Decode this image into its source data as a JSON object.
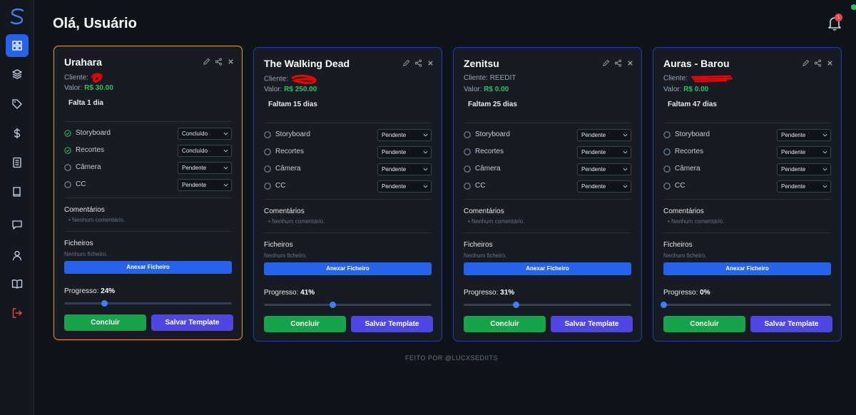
{
  "header": {
    "greeting": "Olá, Usuário",
    "notification_count": "1"
  },
  "sidebar": {
    "items": [
      {
        "name": "dashboard-icon",
        "active": true
      },
      {
        "name": "layers-icon",
        "active": false
      },
      {
        "name": "tag-icon",
        "active": false
      },
      {
        "name": "dollar-icon",
        "active": false
      },
      {
        "name": "document-icon",
        "active": false
      },
      {
        "name": "book-icon",
        "active": false
      },
      {
        "name": "chat-icon",
        "active": false
      },
      {
        "name": "user-icon",
        "active": false
      },
      {
        "name": "open-book-icon",
        "active": false
      },
      {
        "name": "logout-icon",
        "active": false
      }
    ]
  },
  "labels": {
    "client": "Cliente:",
    "value": "Valor:",
    "comments": "Comentários",
    "no_comment": "Nenhum comentário.",
    "files": "Ficheiros",
    "no_files": "Nenhum ficheiro.",
    "attach": "Anexar Ficheiro",
    "progress": "Progresso:",
    "conclude": "Concluir",
    "save_template": "Salvar Template"
  },
  "cards": [
    {
      "title": "Urahara",
      "client": "",
      "value": "R$ 30.00",
      "days": "Falta 1 dia",
      "progress": "24%",
      "progress_value": 24,
      "selected": true,
      "tasks": [
        {
          "label": "Storyboard",
          "status": "Concluído",
          "done": true
        },
        {
          "label": "Recortes",
          "status": "Concluído",
          "done": true
        },
        {
          "label": "Câmera",
          "status": "Pendente",
          "done": false
        },
        {
          "label": "CC",
          "status": "Pendente",
          "done": false
        }
      ]
    },
    {
      "title": "The Walking Dead",
      "client": "",
      "value": "R$ 250.00",
      "days": "Faltam 15 dias",
      "progress": "41%",
      "progress_value": 41,
      "selected": false,
      "tasks": [
        {
          "label": "Storyboard",
          "status": "Pendente",
          "done": false
        },
        {
          "label": "Recortes",
          "status": "Pendente",
          "done": false
        },
        {
          "label": "Câmera",
          "status": "Pendente",
          "done": false
        },
        {
          "label": "CC",
          "status": "Pendente",
          "done": false
        }
      ]
    },
    {
      "title": "Zenitsu",
      "client": "REEDIT",
      "value": "R$ 0.00",
      "days": "Faltam 25 dias",
      "progress": "31%",
      "progress_value": 31,
      "selected": false,
      "tasks": [
        {
          "label": "Storyboard",
          "status": "Pendente",
          "done": false
        },
        {
          "label": "Recortes",
          "status": "Pendente",
          "done": false
        },
        {
          "label": "Câmera",
          "status": "Pendente",
          "done": false
        },
        {
          "label": "CC",
          "status": "Pendente",
          "done": false
        }
      ]
    },
    {
      "title": "Auras - Barou",
      "client": "",
      "value": "R$ 0.00",
      "days": "Faltam 47 dias",
      "progress": "0%",
      "progress_value": 0,
      "selected": false,
      "tasks": [
        {
          "label": "Storyboard",
          "status": "Pendente",
          "done": false
        },
        {
          "label": "Recortes",
          "status": "Pendente",
          "done": false
        },
        {
          "label": "Câmera",
          "status": "Pendente",
          "done": false
        },
        {
          "label": "CC",
          "status": "Pendente",
          "done": false
        }
      ]
    }
  ],
  "footer": "FEITO POR @LUCXSEDIITS",
  "colors": {
    "accent": "#2563eb",
    "success": "#22c55e",
    "template": "#4f46e5",
    "selected_border": "#f59e0b",
    "card_border": "#1e40af"
  }
}
